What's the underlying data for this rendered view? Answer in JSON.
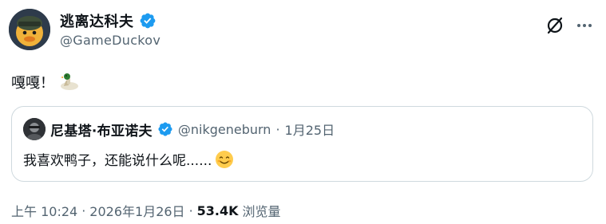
{
  "post": {
    "author_name": "逃离达科夫",
    "author_handle": "@GameDuckov",
    "text": "嘎嘎！",
    "emoji_name": "duck-emoji",
    "time": "上午 10:24",
    "sep1": "·",
    "date": "2026年1月26日",
    "sep2": "·",
    "views_count": "53.4K",
    "views_label": "浏览量"
  },
  "quote": {
    "author_name": "尼基塔·布亚诺夫",
    "author_handle": "@nikgeneburn",
    "sep": "·",
    "date": "1月25日",
    "text": "我喜欢鸭子，还能说什么呢......",
    "emoji_name": "smiling-face-emoji"
  },
  "colors": {
    "verified": "#1d9bf0",
    "text_primary": "#0f1419",
    "text_secondary": "#536471",
    "border": "#cfd9de"
  },
  "icons": {
    "grok": "grok-icon",
    "more": "more-icon",
    "verified": "verified-badge-icon"
  }
}
